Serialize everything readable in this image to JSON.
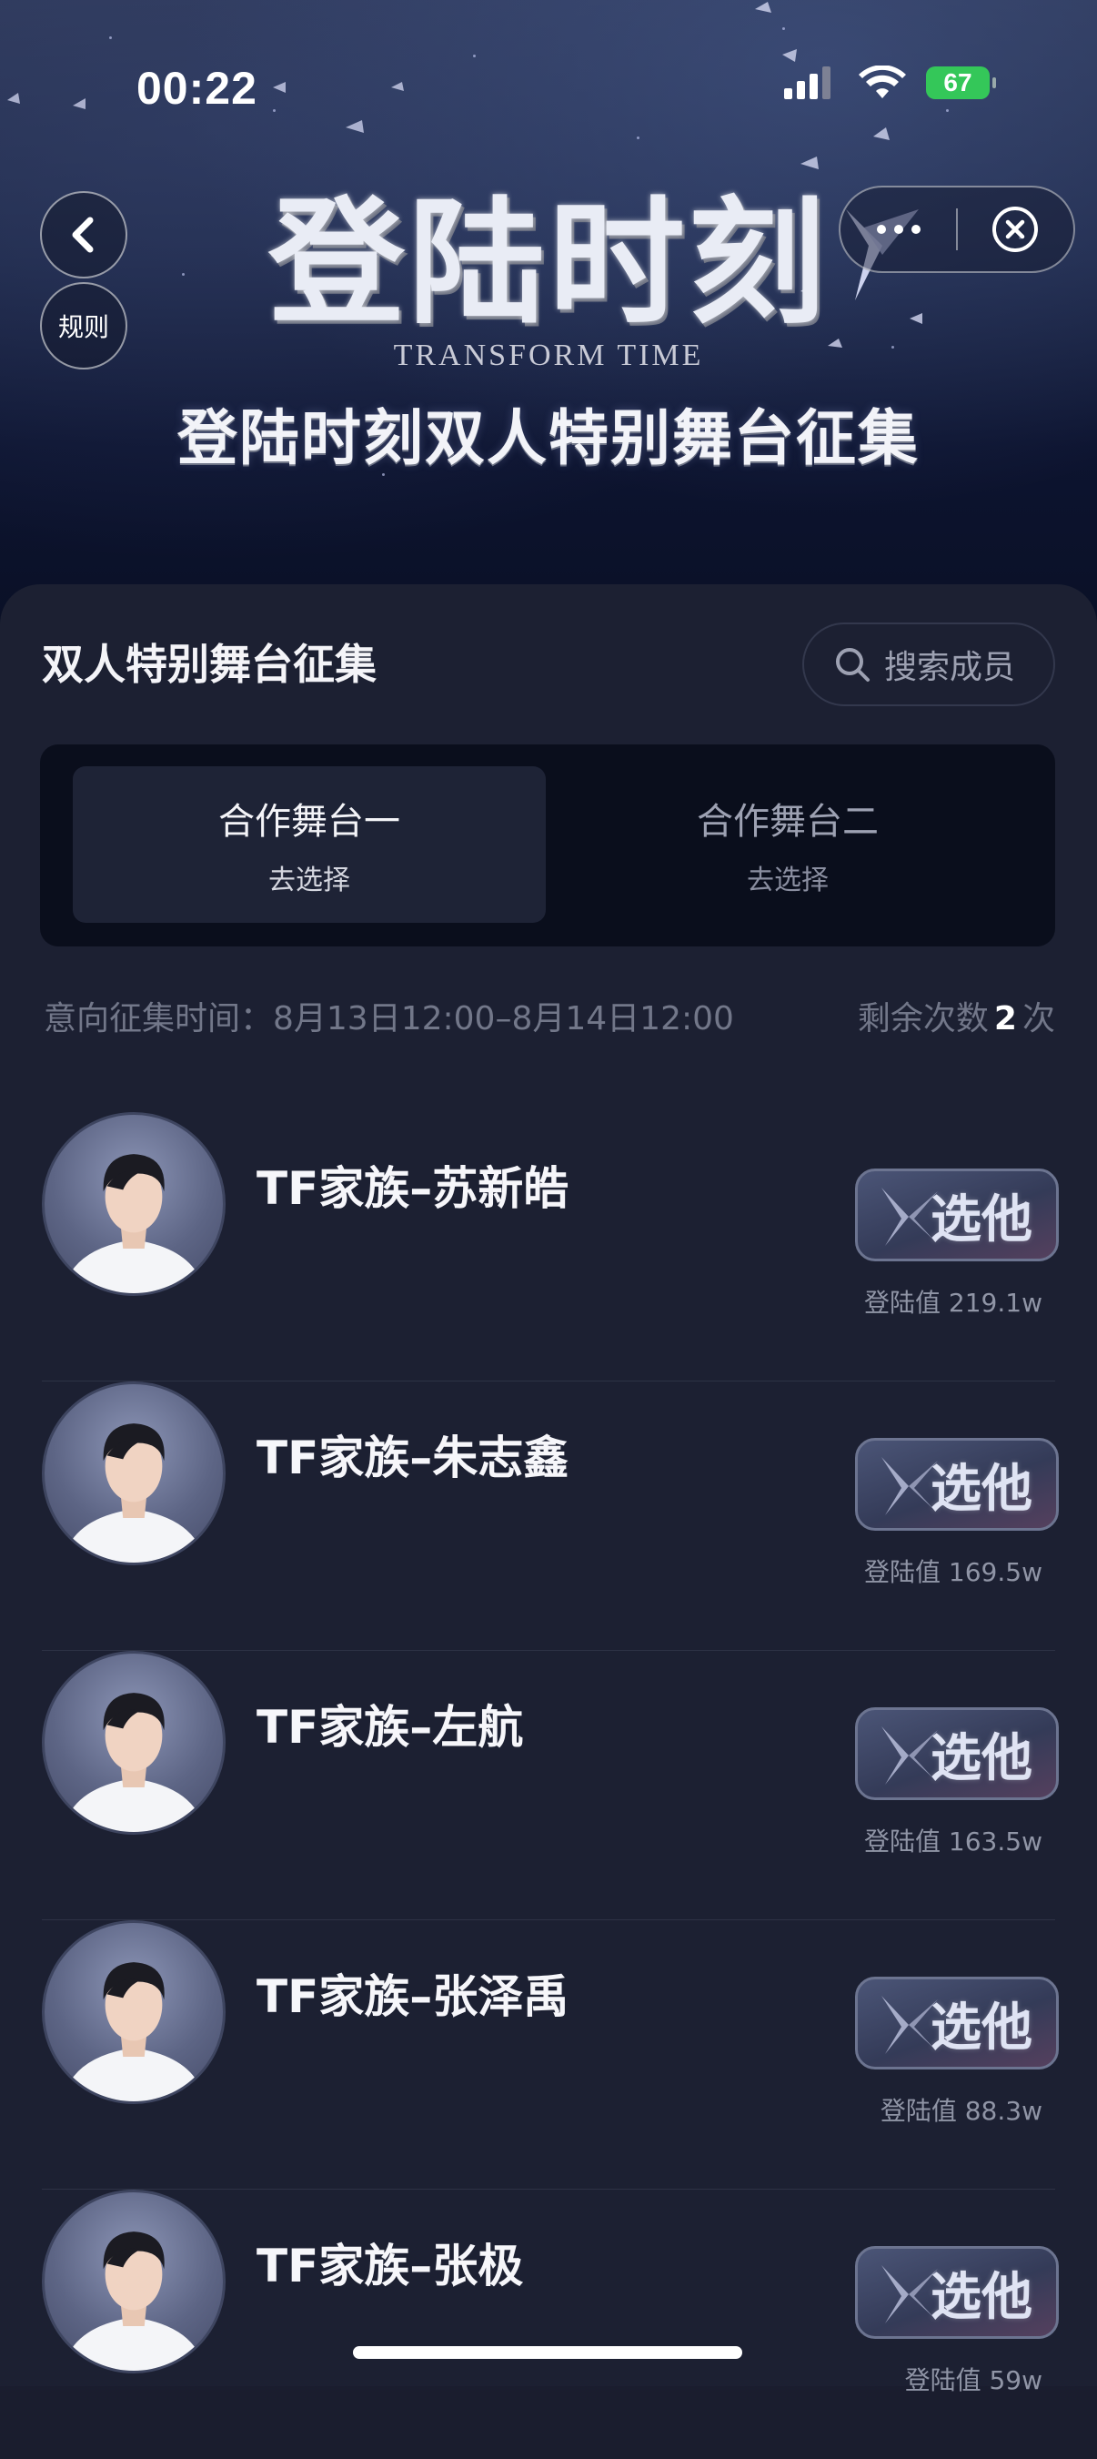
{
  "status_bar": {
    "time": "00:22",
    "battery": "67"
  },
  "header": {
    "logo_title": "登陆时刻",
    "logo_subtitle": "TRANSFORM TIME",
    "banner_title": "登陆时刻双人特别舞台征集",
    "rules_label": "规则",
    "icons": [
      "back-chevron-icon",
      "more-dots-icon",
      "close-circle-icon"
    ]
  },
  "section": {
    "title": "双人特别舞台征集",
    "search_placeholder": "搜索成员"
  },
  "tabs": [
    {
      "name": "合作舞台一",
      "sub": "去选择",
      "active": true
    },
    {
      "name": "合作舞台二",
      "sub": "去选择",
      "active": false
    }
  ],
  "info": {
    "period": "意向征集时间：8月13日12:00–8月14日12:00",
    "remain_label": "剩余次数",
    "remain_count": "2",
    "remain_unit": "次"
  },
  "members": [
    {
      "name": "TF家族–苏新皓",
      "button": "选他",
      "score": "登陆值 219.1w"
    },
    {
      "name": "TF家族–朱志鑫",
      "button": "选他",
      "score": "登陆值 169.5w"
    },
    {
      "name": "TF家族–左航",
      "button": "选他",
      "score": "登陆值 163.5w"
    },
    {
      "name": "TF家族–张泽禹",
      "button": "选他",
      "score": "登陆值 88.3w"
    },
    {
      "name": "TF家族–张极",
      "button": "选他",
      "score": "登陆值 59w"
    }
  ]
}
